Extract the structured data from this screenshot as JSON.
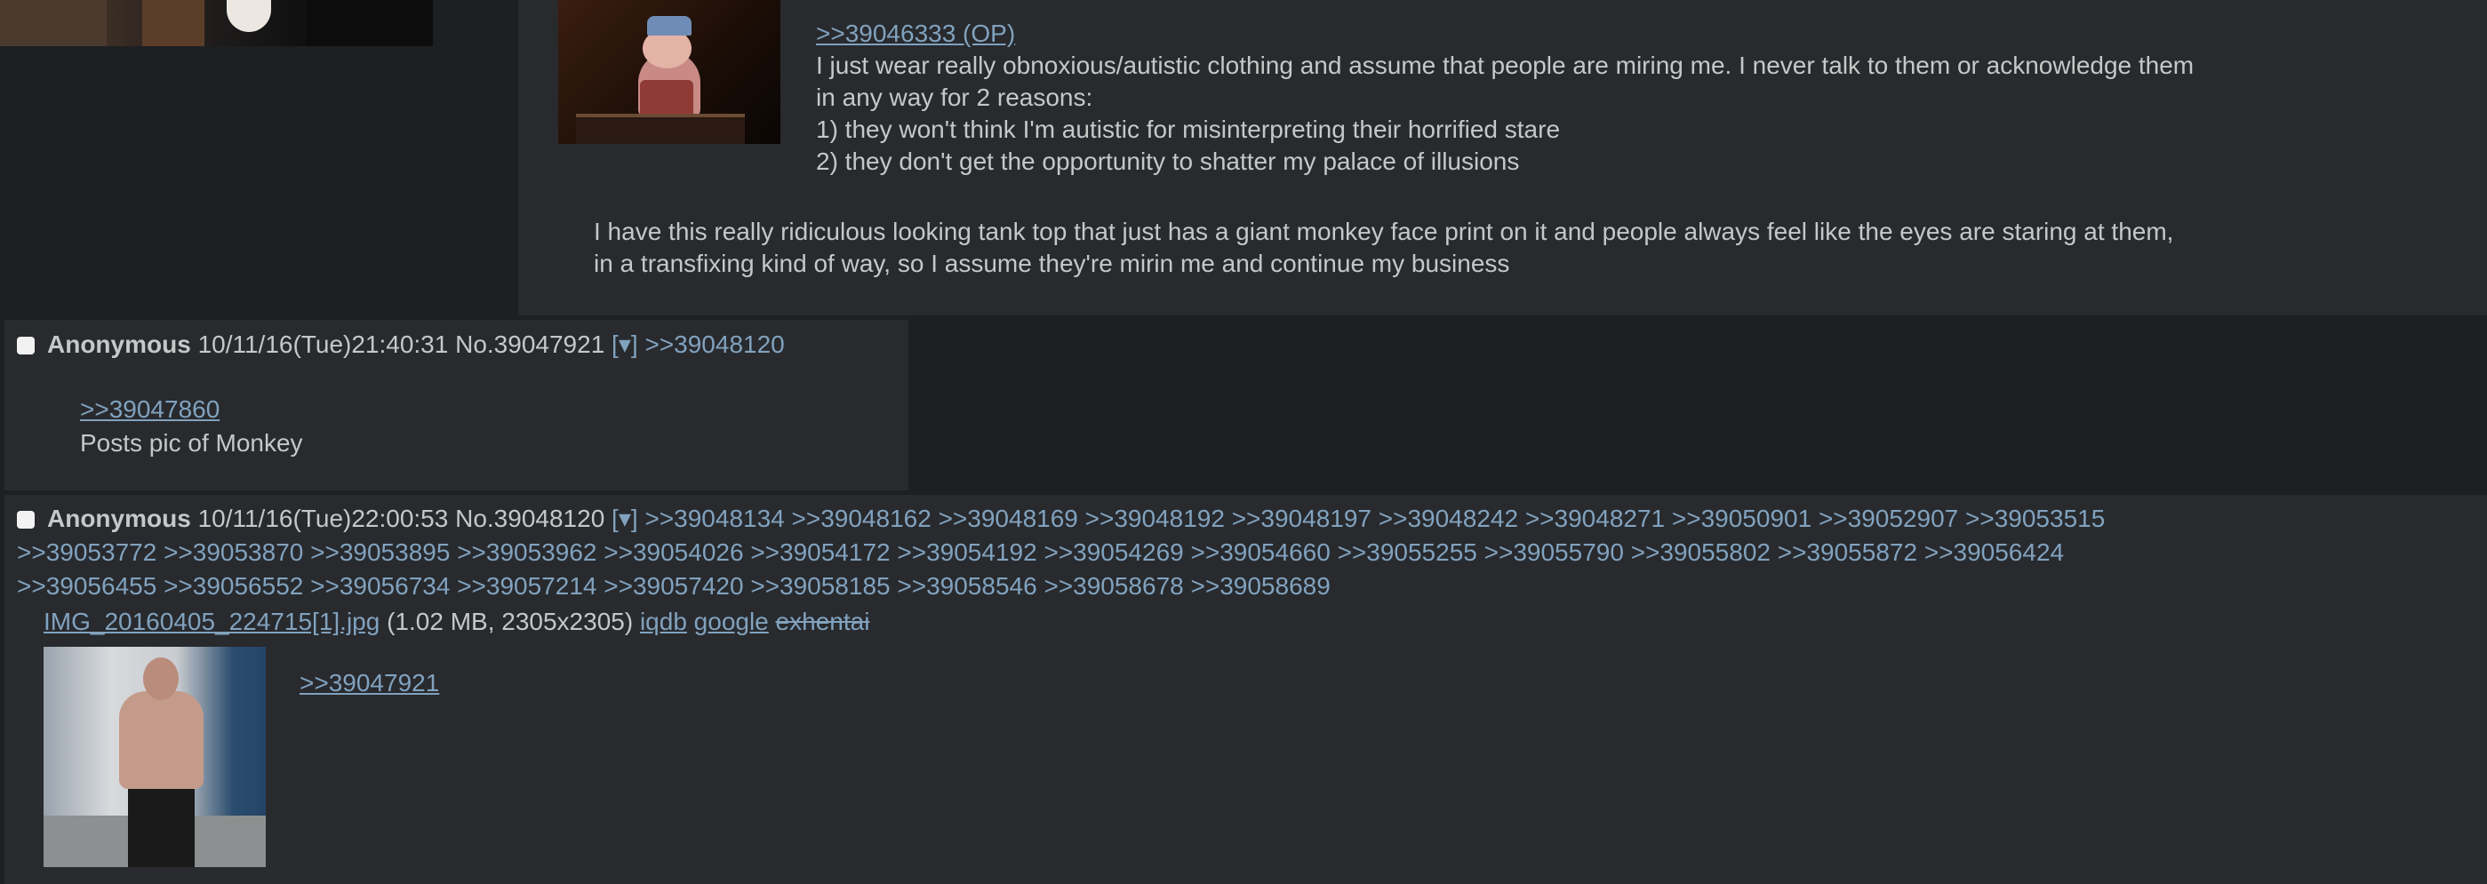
{
  "reply1": {
    "quote_link": ">>39046333 (OP)",
    "lines": [
      "I just wear really obnoxious/autistic clothing and assume that people are miring me. I never talk to them or acknowledge them",
      "in any way for 2 reasons:",
      "1) they won't think I'm autistic for misinterpreting their horrified stare",
      "2) they don't get the opportunity to shatter my palace of illusions"
    ],
    "lines2": [
      "I have this really ridiculous looking tank top that just has a giant monkey face print on it and people always feel like the eyes are staring at them,",
      "in a transfixing kind of way, so I assume they're mirin me and continue my business"
    ]
  },
  "reply2": {
    "name": "Anonymous",
    "datetime": "10/11/16(Tue)21:40:31",
    "post_no": "No.39047921",
    "menu": "[▾]",
    "backlinks": [
      ">>39048120"
    ],
    "quote_link": ">>39047860",
    "body": "Posts pic of Monkey"
  },
  "reply3": {
    "name": "Anonymous",
    "datetime": "10/11/16(Tue)22:00:53",
    "post_no": "No.39048120",
    "menu": "[▾]",
    "backlinks_row1": [
      ">>39048134",
      ">>39048162",
      ">>39048169",
      ">>39048192",
      ">>39048197",
      ">>39048242",
      ">>39048271",
      ">>39050901",
      ">>39052907",
      ">>39053515"
    ],
    "backlinks_row2": [
      ">>39053772",
      ">>39053870",
      ">>39053895",
      ">>39053962",
      ">>39054026",
      ">>39054172",
      ">>39054192",
      ">>39054269",
      ">>39054660",
      ">>39055255",
      ">>39055790",
      ">>39055802",
      ">>39055872",
      ">>39056424"
    ],
    "backlinks_row3": [
      ">>39056455",
      ">>39056552",
      ">>39056734",
      ">>39057214",
      ">>39057420",
      ">>39058185",
      ">>39058546",
      ">>39058678",
      ">>39058689"
    ],
    "file": {
      "name": "IMG_20160405_224715[1].jpg",
      "info": "(1.02 MB, 2305x2305)",
      "search_links": [
        "iqdb",
        "google",
        "exhentai"
      ]
    },
    "quote_link": ">>39047921"
  },
  "colors": {
    "background": "#1d1f21",
    "post_background": "#282a2e",
    "text": "#c5c8c6",
    "link": "#81a2be"
  }
}
